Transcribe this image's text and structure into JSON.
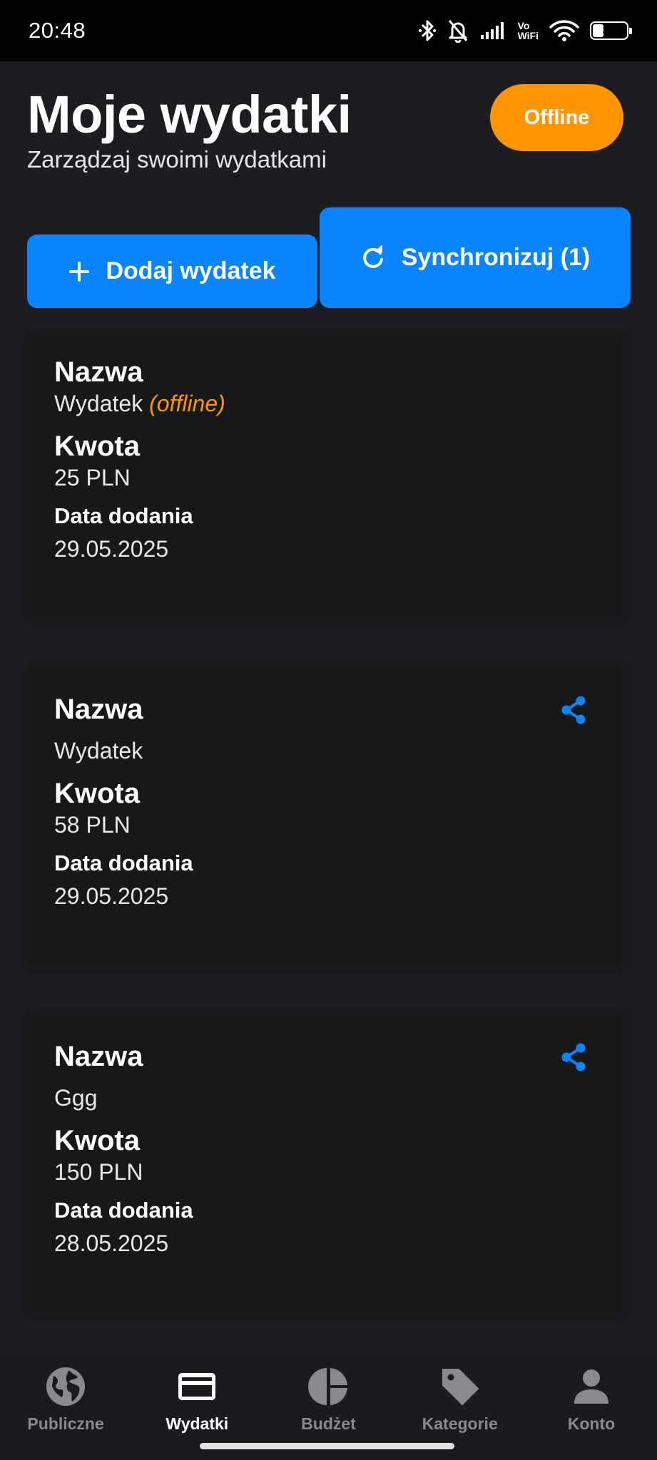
{
  "status_bar": {
    "time": "20:48",
    "vowifi_top": "Vo",
    "vowifi_bottom": "WiFi",
    "battery": "34",
    "battery_level": 0.34,
    "icons": [
      "bluetooth-icon",
      "bell-off-icon",
      "signal-icon",
      "vowifi-icon",
      "wifi-icon",
      "battery-icon"
    ]
  },
  "header": {
    "title": "Moje wydatki",
    "subtitle": "Zarządzaj swoimi wydatkami",
    "badge": "Offline"
  },
  "actions": {
    "add_label": "Dodaj wydatek",
    "sync_label": "Synchronizuj (1)"
  },
  "labels": {
    "name": "Nazwa",
    "amount": "Kwota",
    "date": "Data dodania"
  },
  "expenses": [
    {
      "name": "Wydatek",
      "offline_tag": "(offline)",
      "amount": "25 PLN",
      "date": "29.05.2025",
      "shareable": false
    },
    {
      "name": "Wydatek",
      "amount": "58 PLN",
      "date": "29.05.2025",
      "shareable": true
    },
    {
      "name": "Ggg",
      "amount": "150 PLN",
      "date": "28.05.2025",
      "shareable": true
    }
  ],
  "nav": {
    "items": [
      {
        "label": "Publiczne",
        "icon": "globe-icon",
        "active": false
      },
      {
        "label": "Wydatki",
        "icon": "card-icon",
        "active": true
      },
      {
        "label": "Budżet",
        "icon": "pie-chart-icon",
        "active": false
      },
      {
        "label": "Kategorie",
        "icon": "tag-icon",
        "active": false
      },
      {
        "label": "Konto",
        "icon": "person-icon",
        "active": false
      }
    ]
  },
  "colors": {
    "accent": "#0a84ff",
    "offline": "#ff9500",
    "background": "#1c1d20"
  }
}
